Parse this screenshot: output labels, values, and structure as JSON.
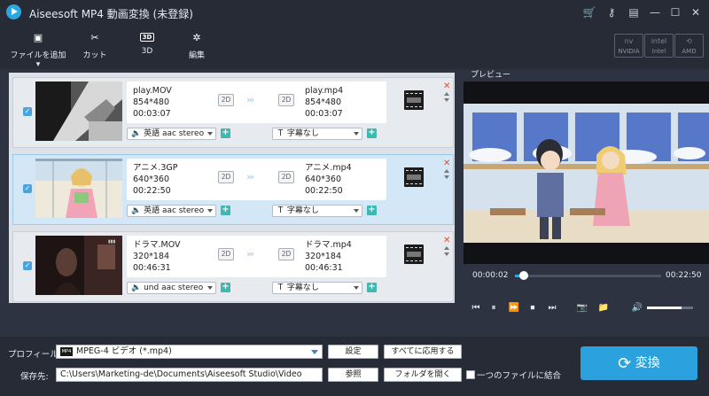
{
  "window": {
    "title": "Aiseesoft MP4 動画変換 (未登録)"
  },
  "toolbar": {
    "add_file": "ファイルを追加",
    "cut": "カット",
    "three_d": "3D",
    "edit": "編集",
    "accel": [
      "NVIDIA",
      "Intel",
      "AMD"
    ]
  },
  "files": [
    {
      "src_name": "play.MOV",
      "src_res": "854*480",
      "src_dur": "00:03:07",
      "out_name": "play.mp4",
      "out_res": "854*480",
      "out_dur": "00:03:07",
      "audio": "英語 aac stereo",
      "subtitle": "字幕なし",
      "badge": "2D",
      "checked": true
    },
    {
      "src_name": "アニメ.3GP",
      "src_res": "640*360",
      "src_dur": "00:22:50",
      "out_name": "アニメ.mp4",
      "out_res": "640*360",
      "out_dur": "00:22:50",
      "audio": "英語 aac stereo",
      "subtitle": "字幕なし",
      "badge": "2D",
      "checked": true
    },
    {
      "src_name": "ドラマ.MOV",
      "src_res": "320*184",
      "src_dur": "00:46:31",
      "out_name": "ドラマ.mp4",
      "out_res": "320*184",
      "out_dur": "00:46:31",
      "audio": "und aac stereo",
      "subtitle": "字幕なし",
      "badge": "2D",
      "checked": true
    }
  ],
  "preview": {
    "header": "プレビュー",
    "current_time": "00:00:02",
    "total_time": "00:22:50",
    "progress": 0.06,
    "volume": 0.75
  },
  "bottom": {
    "profile_label": "プロフィール:",
    "profile_value": "MPEG-4 ビデオ (*.mp4)",
    "settings_button": "設定",
    "apply_all_button": "すべてに応用する",
    "dest_label": "保存先:",
    "dest_value": "C:\\Users\\Marketing-de\\Documents\\Aiseesoft Studio\\Video",
    "browse_button": "参照",
    "open_folder_button": "フォルダを開く",
    "merge_label": "一つのファイルに結合",
    "convert_button": "変換"
  },
  "colors": {
    "accent": "#2ba1de",
    "close": "#e2502f",
    "plus": "#3fb8b0"
  }
}
